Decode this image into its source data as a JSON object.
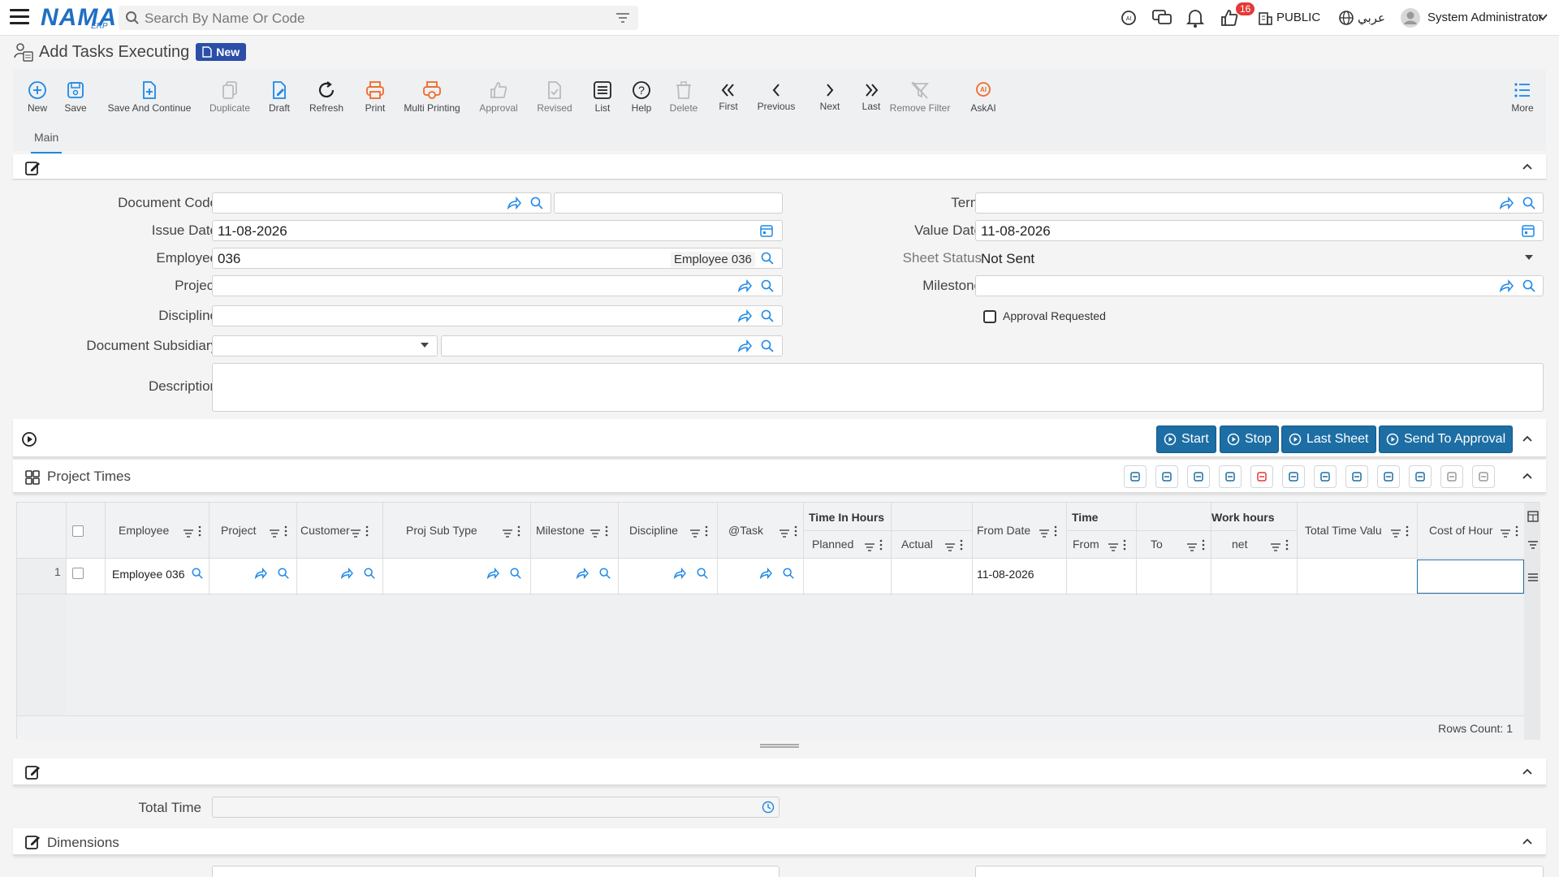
{
  "topbar": {
    "logo": "NAMA",
    "logo_sub": "ERP",
    "search_placeholder": "Search By Name Or Code",
    "notification_count": "16",
    "branch": "PUBLIC",
    "language": "عربي",
    "user": "System Administrator"
  },
  "page": {
    "title": "Add Tasks Executing",
    "status_badge": "New"
  },
  "toolbar": {
    "items": [
      "New",
      "Save",
      "Save And Continue",
      "Duplicate",
      "Draft",
      "Refresh",
      "Print",
      "Multi Printing",
      "Approval",
      "Revised",
      "List",
      "Help",
      "Delete",
      "First",
      "Previous",
      "Next",
      "Last",
      "Remove Filter",
      "AskAI",
      "More"
    ]
  },
  "tabs": {
    "main": "Main"
  },
  "form": {
    "document_code_label": "Document Code",
    "issue_date_label": "Issue Date",
    "issue_date_value": "11-08-2026",
    "employee_label": "Employee",
    "employee_code": "036",
    "employee_name": "Employee 036",
    "project_label": "Project",
    "discipline_label": "Discipline",
    "document_subsidiary_label": "Document Subsidiary",
    "description_label": "Description",
    "term_label": "Term",
    "value_date_label": "Value Date",
    "value_date_value": "11-08-2026",
    "sheet_status_label": "Sheet Status",
    "sheet_status_value": "Not Sent",
    "milestone_label": "Milestone",
    "approval_requested_label": "Approval Requested"
  },
  "actions": {
    "start": "Start",
    "stop": "Stop",
    "last_sheet": "Last Sheet",
    "send_to_approval": "Send To Approval"
  },
  "project_times": {
    "title": "Project Times",
    "headers": {
      "employee": "Employee",
      "project": "Project",
      "customer": "Customer",
      "proj_sub_type": "Proj Sub Type",
      "milestone": "Milestone",
      "discipline": "Discipline",
      "task": "@Task",
      "time_in_hours": "Time In Hours",
      "planned": "Planned",
      "actual": "Actual",
      "from_date": "From Date",
      "time": "Time",
      "from": "From",
      "to": "To",
      "work_hours": "Work hours",
      "net": "net",
      "total_time_value": "Total Time Valu",
      "cost_of_hour": "Cost of Hour"
    },
    "rows": [
      {
        "index": "1",
        "employee": "Employee 036",
        "from_date": "11-08-2026"
      }
    ],
    "rows_count": "Rows Count: 1"
  },
  "footer_form": {
    "total_time_label": "Total Time"
  },
  "dimensions": {
    "title": "Dimensions"
  }
}
